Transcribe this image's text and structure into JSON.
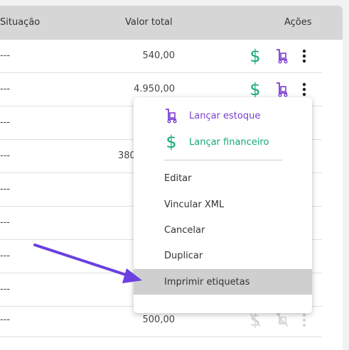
{
  "header": {
    "col_situation": "Situação",
    "col_total": "Valor total",
    "col_actions": "Ações"
  },
  "rows": [
    {
      "situation": "---",
      "total": "540,00"
    },
    {
      "situation": "---",
      "total": "4.950,00"
    },
    {
      "situation": "---",
      "total": ""
    },
    {
      "situation": "---",
      "total": "380"
    },
    {
      "situation": "---",
      "total": ""
    },
    {
      "situation": "---",
      "total": ""
    },
    {
      "situation": "---",
      "total": ""
    },
    {
      "situation": "---",
      "total": ""
    },
    {
      "situation": "---",
      "total": "500,00"
    }
  ],
  "menu": {
    "items": [
      {
        "label": "Lançar estoque",
        "color": "#7a3fd1",
        "icon": "stock-cart-icon"
      },
      {
        "label": "Lançar financeiro",
        "color": "#13a87a",
        "icon": "dollar-icon"
      },
      {
        "label": "Editar"
      },
      {
        "label": "Vincular XML"
      },
      {
        "label": "Cancelar"
      },
      {
        "label": "Duplicar"
      },
      {
        "label": "Imprimir etiquetas",
        "highlighted": true
      }
    ]
  },
  "colors": {
    "accent_purple": "#7a3fd1",
    "accent_green": "#13a87a",
    "arrow": "#6b3fe0",
    "header_bg": "#d6d6d6"
  }
}
